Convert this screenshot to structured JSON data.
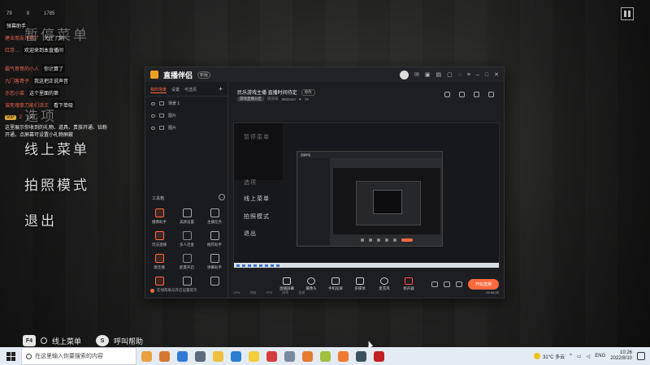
{
  "chat": {
    "stats": [
      "79",
      "8",
      "1785"
    ],
    "header_label": "弹幕助手",
    "lines": [
      {
        "name": "…",
        "msg": "欢迎 …"
      },
      {
        "name": "建业朋友开播了",
        "msg": "关注了你"
      },
      {
        "name": "红芽…",
        "msg": "欢迎来到本直播间"
      },
      {
        "name": "霸气哥哥的小人",
        "msg": "你计算了"
      },
      {
        "name": "九门客哥子",
        "msg": "我这把正说声音"
      },
      {
        "name": "亦您小菜",
        "msg": "这个里面的第"
      },
      {
        "name": "该死魂拳刀能们活王",
        "msg": "看下单吸"
      },
      {
        "name": "2",
        "msg": "2号",
        "badge": "VIP"
      }
    ],
    "note": "这里展示你收到的礼物、道具、贵族开通、钻粉开通，点屏幕可设置小礼物屏蔽"
  },
  "game_menu": {
    "items": [
      "暂停菜单",
      "选项",
      "线上菜单",
      "拍照模式",
      "退出"
    ]
  },
  "hotkeys": {
    "f4_key": "F4",
    "f4_label": "线上菜单",
    "s_key": "S",
    "s_label": "呼叫帮助"
  },
  "app": {
    "title": "直播伴侣",
    "version": "新版",
    "left_tabs": [
      "我的场景",
      "设置",
      "可选页"
    ],
    "scenes": [
      "场景 1",
      "图片",
      "图片"
    ],
    "tools_title": "工具箱",
    "tools": [
      "摄像助手",
      "美颜设置",
      "主播任务",
      "玩法直播",
      "多人连麦",
      "推荐助手",
      "歌连播",
      "能量开启",
      "弹幕助手",
      "",
      "",
      ""
    ],
    "footer": "在线帮助与开启设置提示",
    "room_title": "民乐游戏主播 直播时间待定",
    "room_edit": "修改",
    "room_tag": "游戏直播分区",
    "room_id_label": "房间号",
    "room_id": "9800442",
    "room_likes": "79",
    "bottom_tools": [
      "直播屏幕",
      "摄像头",
      "手机投屏",
      "多媒体",
      "麦克风",
      "扬声器"
    ],
    "live_button": "开始直播",
    "status": [
      "CPU",
      "内存",
      "FPS",
      "码率",
      "丢帧"
    ],
    "timer": "00:56:52",
    "preview_menu": [
      "暂停菜单",
      "选项",
      "线上菜单",
      "拍照模式",
      "退出"
    ]
  },
  "taskbar": {
    "search_placeholder": "在这里输入你要搜索的内容",
    "weather": "31°C 多云",
    "lang": "ENG",
    "time": "10:26",
    "date": "2022/8/10"
  },
  "colors": {
    "accent": "#ff6a3d",
    "menu_text": "#d9d9d9"
  }
}
